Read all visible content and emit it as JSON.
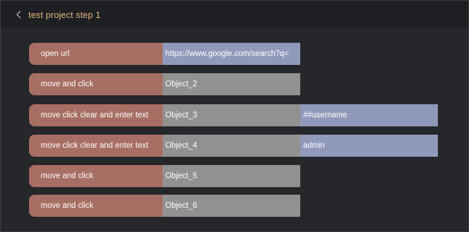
{
  "header": {
    "back_icon": "chevron-left-icon",
    "title": "test project step 1"
  },
  "colors": {
    "header_bg": "#1d1f23",
    "canvas_bg": "#25272b",
    "title": "#e6b877",
    "action_block": "#a76e63",
    "object_block": "#939090",
    "value_block": "#9199bb"
  },
  "steps": [
    {
      "action": "open url",
      "target": "https://www.google.com/search?q=",
      "value": ""
    },
    {
      "action": "move and click",
      "target": "Object_2",
      "value": ""
    },
    {
      "action": "move click clear and enter text",
      "target": "Object_3",
      "value": "##username"
    },
    {
      "action": "move click clear and enter text",
      "target": "Object_4",
      "value": "admin"
    },
    {
      "action": "move and click",
      "target": "Object_5",
      "value": ""
    },
    {
      "action": "move and click",
      "target": "Object_6",
      "value": ""
    }
  ]
}
